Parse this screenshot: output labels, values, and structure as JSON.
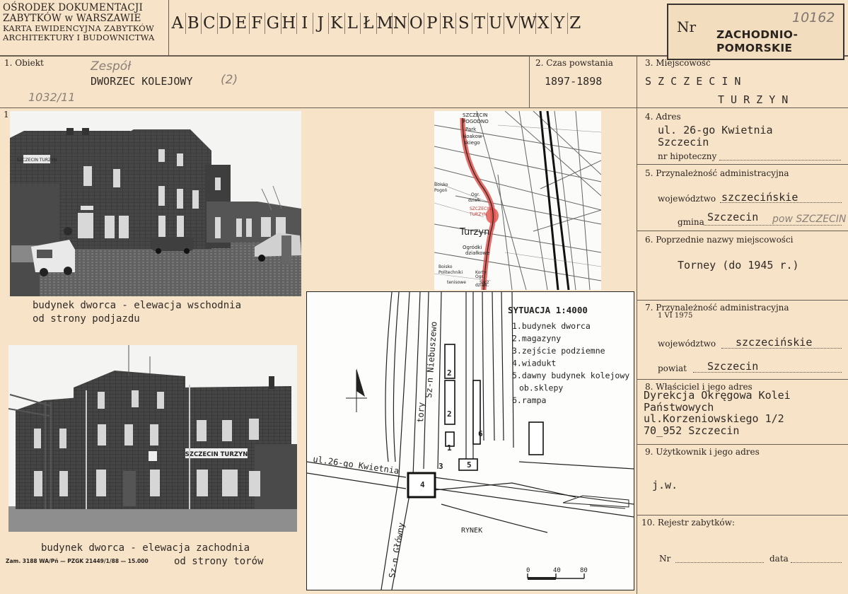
{
  "header": {
    "institution_line1": "OŚRODEK DOKUMENTACJI",
    "institution_line2": "ZABYTKÓW w WARSZAWIE",
    "card_line1": "KARTA EWIDENCYJNA ZABYTKÓW",
    "card_line2": "ARCHITEKTURY I BUDOWNICTWA",
    "alphabet": [
      "A",
      "B",
      "C",
      "D",
      "E",
      "F",
      "G",
      "H",
      "I",
      "J",
      "K",
      "L",
      "Ł",
      "M",
      "N",
      "O",
      "P",
      "R",
      "S",
      "T",
      "U",
      "V",
      "W",
      "X",
      "Y",
      "Z"
    ],
    "nr_label": "Nr",
    "nr_value": "10162",
    "stamp_line1": "ZACHODNIO-",
    "stamp_line2": "POMORSKIE"
  },
  "object": {
    "label": "1. Obiekt",
    "handwritten_above": "Zespół",
    "value": "DWORZEC  KOLEJOWY",
    "handwritten_suffix": "(2)",
    "handwritten_ref": "1032/11"
  },
  "period": {
    "label": "2. Czas powstania",
    "value": "1897-1898"
  },
  "locality": {
    "label": "3. Miejscowość",
    "line1": "S Z C Z E C I N",
    "line2": "T U R Z Y N"
  },
  "address": {
    "label": "4. Adres",
    "line1": "ul. 26-go Kwietnia",
    "line2": "Szczecin",
    "mortgage_label": "nr hipoteczny"
  },
  "admin": {
    "label": "5. Przynależność administracyjna",
    "voivodeship_label": "województwo",
    "voivodeship_value": "szczecińskie",
    "commune_label": "gmina",
    "commune_value": "Szczecin",
    "commune_hand": "pow SZCZECIN"
  },
  "former_names": {
    "label": "6. Poprzednie nazwy miejscowości",
    "value": "Torney (do 1945 r.)"
  },
  "admin1975": {
    "label": "7. Przynależność administracyjna",
    "date": "1 VI 1975",
    "voivodeship_label": "województwo",
    "voivodeship_value": "szczecińskie",
    "county_label": "powiat",
    "county_value": "Szczecin"
  },
  "owner": {
    "label": "8. Właściciel i jego adres",
    "line1": "Dyrekcja Okręgowa Kolei",
    "line2": "Państwowych",
    "line3": "ul.Korzeniowskiego 1/2",
    "line4": "70_952  Szczecin"
  },
  "user": {
    "label": "9. Użytkownik i jego adres",
    "value": "j.w."
  },
  "register": {
    "label": "10. Rejestr zabytków:",
    "nr_label": "Nr",
    "date_label": "data"
  },
  "photos": {
    "photo1_sign": "SZCZECIN TURZYN",
    "photo1_caption_line1": "budynek dworca - elewacja wschodnia",
    "photo1_caption_line2": "od strony podjazdu",
    "photo2_sign": "SZCZECIN TURZYN",
    "photo2_caption_line1": "budynek dworca - elewacja zachodnia",
    "photo2_caption_line2": "od strony torów",
    "print_note": "Zam. 3188 WA/Pń — PZGK 21449/1/88 — 15.000"
  },
  "map": {
    "labels": [
      "SZCZECIN",
      "POGODNO",
      "Park",
      "Noakow-",
      "skiego",
      "Boisko",
      "Pogoń",
      "Ogr.",
      "działk",
      "SZCZECIN",
      "TURZYN",
      "Turzyn",
      "Ogródki",
      "działkowe",
      "Boisko",
      "Politechniki",
      "Korty",
      "tenisowe",
      "Szcz",
      "Ogr.",
      "działk."
    ]
  },
  "situation": {
    "title": "SYTUACJA 1:4000",
    "legend": [
      "1.budynek dworca",
      "2.magazyny",
      "3.zejście podziemne",
      "4.wiadukt",
      "5.dawny budynek kolejowy",
      "ob.sklepy",
      "6.rampa"
    ],
    "street_label": "ul.26-go Kwietnia",
    "track_label1": "Sz-n Niebuszewo",
    "track_label2": "tory",
    "track_label3": "Sz-n Główny",
    "square_label": "RYNEK",
    "scale_labels": [
      "0",
      "40",
      "80"
    ],
    "numbers": [
      "1",
      "2",
      "2",
      "3",
      "4",
      "5",
      "6"
    ]
  }
}
